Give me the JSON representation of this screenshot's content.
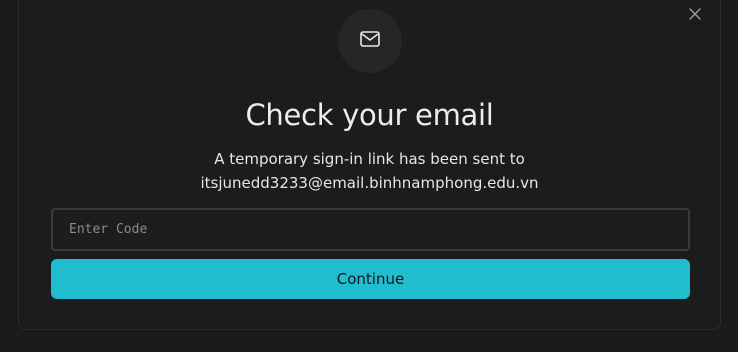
{
  "dialog": {
    "title": "Check your email",
    "description_line1": "A temporary sign-in link has been sent to",
    "email": "itsjunedd3233@email.binhnamphong.edu.vn",
    "icon": "mail-icon",
    "close_icon": "close-icon"
  },
  "code_input": {
    "placeholder": "Enter Code",
    "value": ""
  },
  "continue_button": {
    "label": "Continue"
  },
  "colors": {
    "background": "#1a1b1b",
    "accent": "#21bccd",
    "text": "#ececec"
  }
}
